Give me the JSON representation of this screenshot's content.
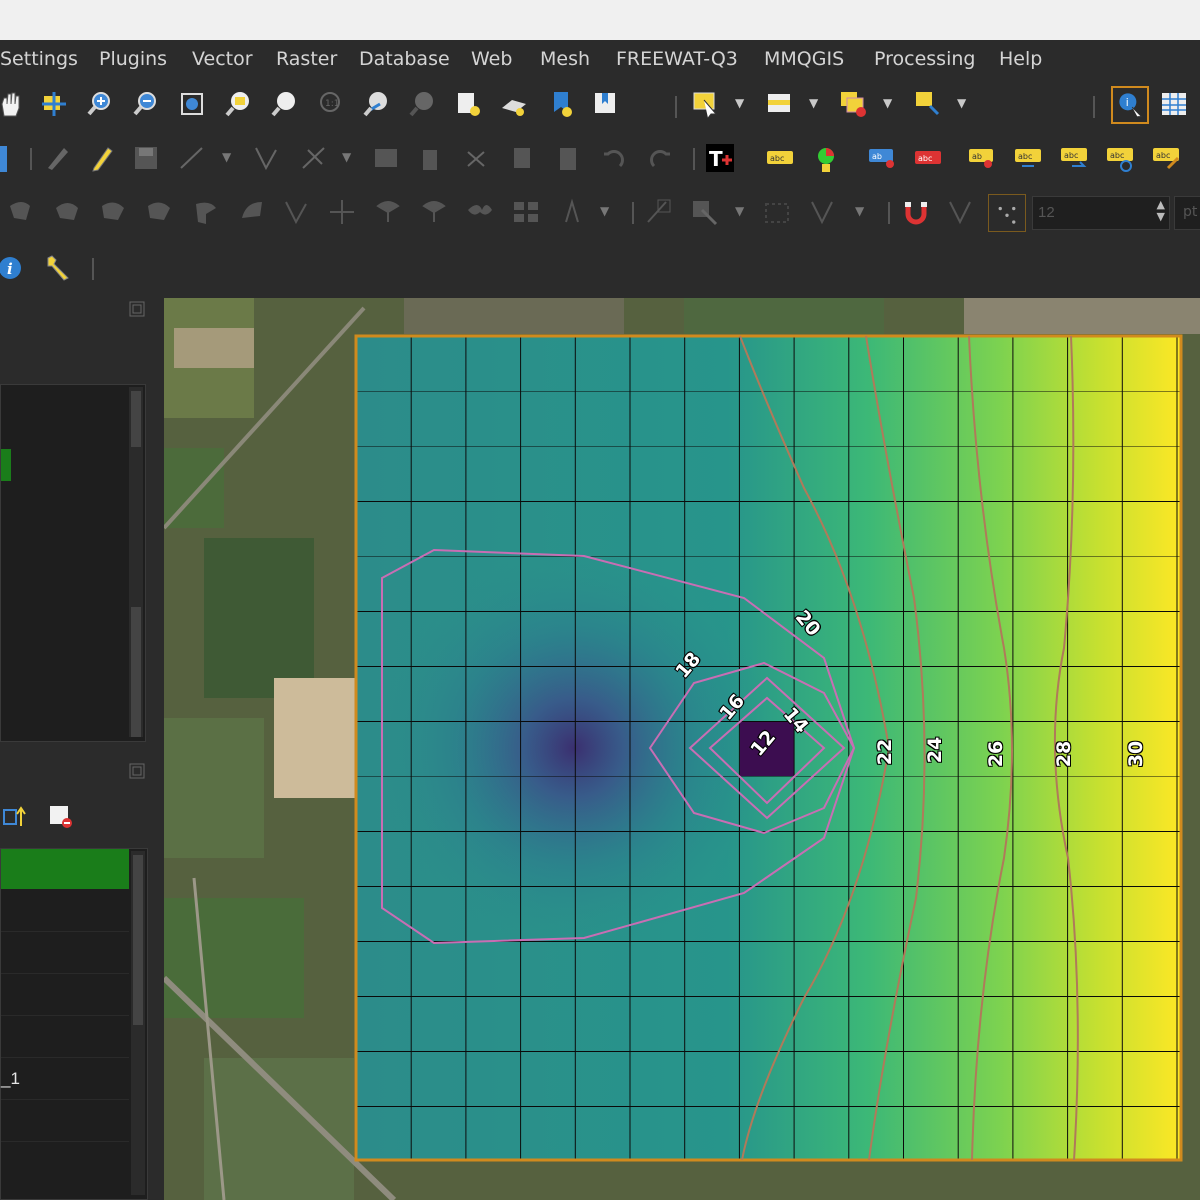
{
  "menu": [
    "Settings",
    "Plugins",
    "Vector",
    "Raster",
    "Database",
    "Web",
    "Mesh",
    "FREEWAT-Q3",
    "MMQGIS",
    "Processing",
    "Help"
  ],
  "toolbar3": {
    "font_size_value": "12",
    "unit_label": "pt"
  },
  "layers_panel": {
    "visible_layer_suffix": "_1"
  },
  "map": {
    "contour_labels": [
      "12",
      "14",
      "16",
      "18",
      "20",
      "22",
      "24",
      "26",
      "28",
      "30"
    ]
  },
  "colors": {
    "accent_green": "#1a7d1a",
    "grid_border": "#d08a1e",
    "contour_dark": "#c86eb4",
    "contour_light": "#b07a5a"
  }
}
